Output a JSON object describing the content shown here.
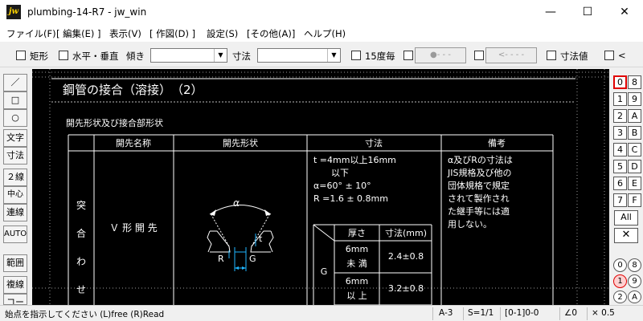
{
  "window": {
    "title": "plumbing-14-R7 - jw_win",
    "icon_label": "jw",
    "minimize": "—",
    "maximize": "☐",
    "close": "✕"
  },
  "menu": [
    "ファイル(F)",
    "[ 編集(E) ]",
    "表示(V)",
    "[ 作図(D) ]",
    "設定(S)",
    "[その他(A)]",
    "ヘルプ(H)"
  ],
  "toolbar": {
    "rect": "矩形",
    "hv": "水平・垂直",
    "tilt": "傾き",
    "tilt_value": "",
    "dim": "寸法",
    "dim_value": "",
    "deg15": "15度毎",
    "btn1": "●- - -",
    "btn2": "<- - - -",
    "dimval": "寸法値",
    "lt": "<"
  },
  "left_tools": [
    "／",
    "□",
    "○",
    "文字",
    "寸法",
    "２線",
    "中心線",
    "連線",
    "AUTO",
    "範囲",
    "複線",
    "コーナー"
  ],
  "right_layers": {
    "col1": [
      "0",
      "1",
      "2",
      "3",
      "4",
      "5",
      "6",
      "7"
    ],
    "col2": [
      "8",
      "9",
      "A",
      "B",
      "C",
      "D",
      "E",
      "F"
    ],
    "active": "0",
    "all": "All",
    "x": "✕",
    "group_col1": [
      "0",
      "1",
      "2"
    ],
    "group_col2": [
      "8",
      "9",
      "A"
    ],
    "group_active": "1"
  },
  "drawing": {
    "title": "鋼管の接合（溶接）　（2）",
    "subtitle": "開先形状及び接合部形状",
    "headers": [
      "開先名称",
      "開先形状",
      "寸法",
      "備考"
    ],
    "row_label_chars": [
      "突",
      "合",
      "わ",
      "せ"
    ],
    "groove_name": "Ｖ 形 開 先",
    "alpha": "α",
    "label_R": "R",
    "label_G": "G",
    "label_t": "t",
    "dims": [
      "t =4mm以上16mm",
      "以下",
      "α=60°  ±  10°",
      "R =1.6  ± 0.8mm"
    ],
    "inner_headers": [
      "厚さ",
      "寸法(mm)"
    ],
    "inner_row_label": "G",
    "inner_rows": [
      {
        "t1": "6mm",
        "t2": "未 満",
        "val": "2.4±0.8"
      },
      {
        "t1": "6mm",
        "t2": "以 上",
        "val": "3.2±0.8"
      }
    ],
    "remarks": [
      "α及びRの寸法は",
      "JIS規格及び他の",
      "団体規格で規定",
      "されて製作され",
      "た継手等には適",
      "用しない。"
    ]
  },
  "status": {
    "message": "始点を指示してください (L)free (R)Read",
    "paper": "A-3",
    "scale": "S=1/1",
    "layer": "[0-1]0-0",
    "angle": "∠0",
    "zoom": "× 0.5"
  }
}
